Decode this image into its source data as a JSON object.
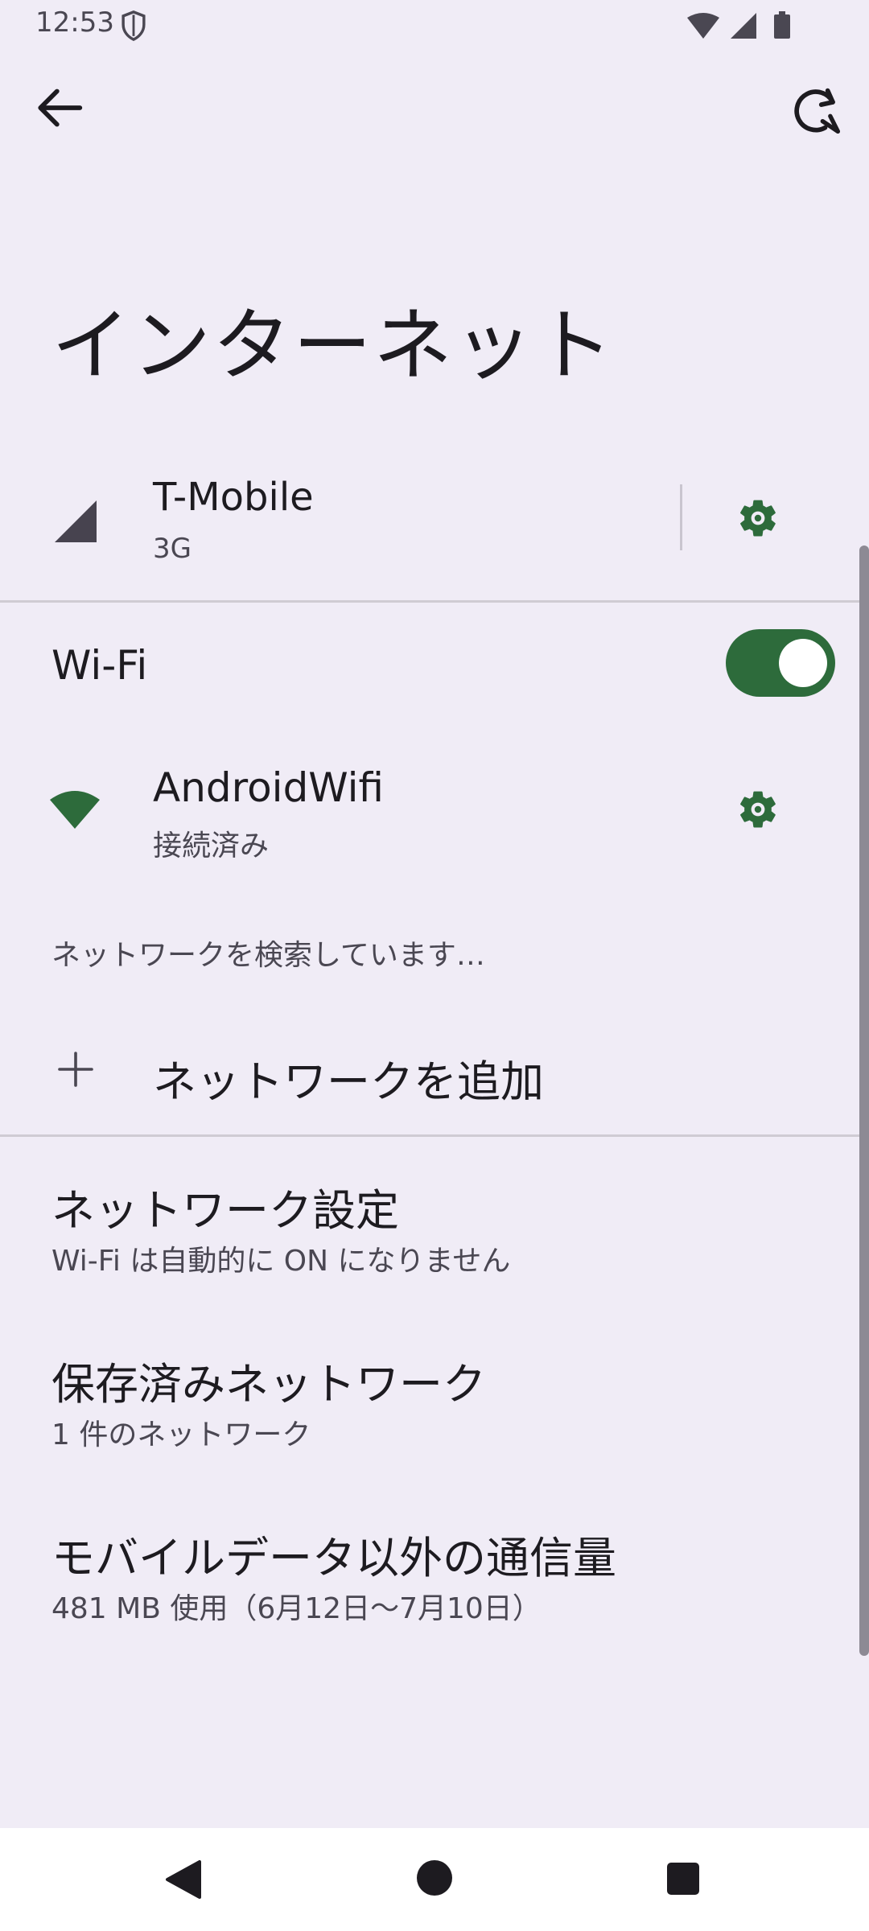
{
  "status_bar": {
    "time": "12:53",
    "icons": [
      "shield-icon",
      "wifi-icon",
      "signal-icon",
      "battery-icon"
    ]
  },
  "app_bar": {
    "back_icon": "arrow-back-icon",
    "help_icon": "help-refresh-icon"
  },
  "page": {
    "title": "インターネット"
  },
  "mobile_network": {
    "name": "T-Mobile",
    "type": "3G",
    "settings_icon": "gear-icon"
  },
  "wifi": {
    "label": "Wi-Fi",
    "enabled": true,
    "network": {
      "name": "AndroidWifi",
      "status": "接続済み",
      "settings_icon": "gear-icon"
    },
    "scanning_text": "ネットワークを検索しています…",
    "add_network_label": "ネットワークを追加"
  },
  "items": [
    {
      "title": "ネットワーク設定",
      "subtitle": "Wi-Fi は自動的に ON になりません"
    },
    {
      "title": "保存済みネットワーク",
      "subtitle": "1 件のネットワーク"
    },
    {
      "title": "モバイルデータ以外の通信量",
      "subtitle": "481 MB 使用（6月12日〜7月10日）"
    }
  ],
  "colors": {
    "background": "#f0ecf6",
    "accent": "#2d6b3b",
    "text_primary": "#1d1b20",
    "text_secondary": "#4a4752"
  }
}
